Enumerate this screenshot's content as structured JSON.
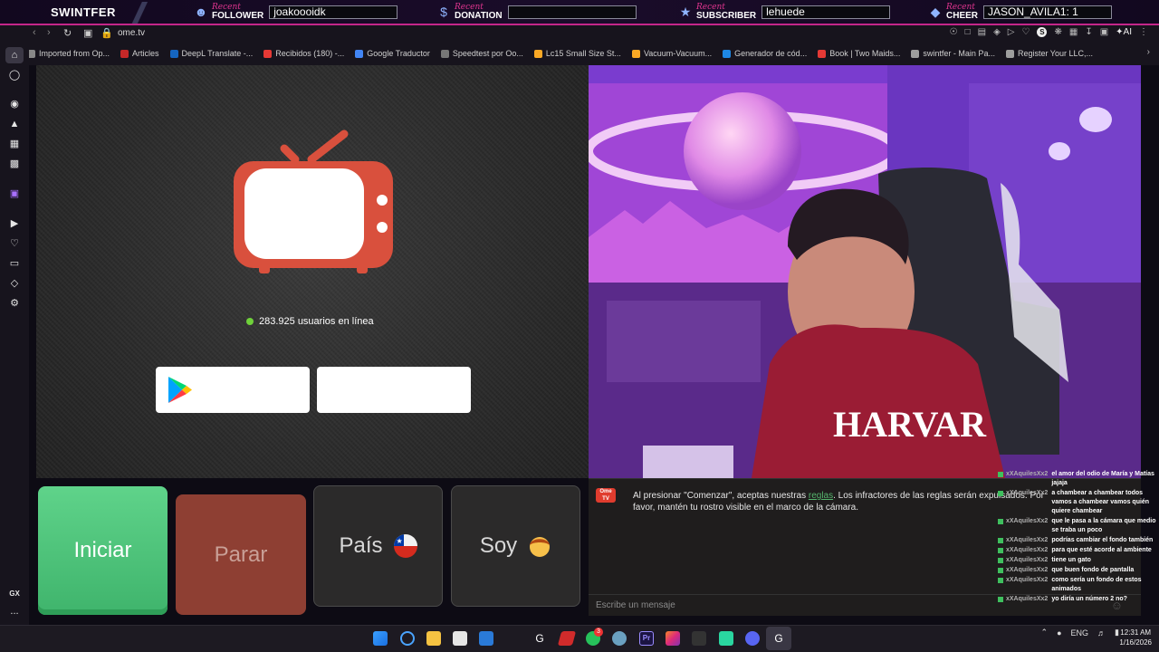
{
  "overlay": {
    "brand": "SWINTFER",
    "recent": "Recent",
    "follower": {
      "label": "FOLLOWER",
      "value": "joakoooidk"
    },
    "donation": {
      "label": "DONATION",
      "value": ""
    },
    "subscriber": {
      "label": "SUBSCRIBER",
      "value": "lehuede"
    },
    "cheer": {
      "label": "CHEER",
      "value": "JASON_AVILA1: 1"
    }
  },
  "browser": {
    "url": "ome.tv",
    "bookmarks": [
      {
        "label": "Imported from Op...",
        "color": "#888888"
      },
      {
        "label": "Articles",
        "color": "#c62828"
      },
      {
        "label": "DeepL Translate -...",
        "color": "#1565c0"
      },
      {
        "label": "Recibidos (180) -...",
        "color": "#e53935"
      },
      {
        "label": "Google Traductor",
        "color": "#4285f4"
      },
      {
        "label": "Speedtest por Oo...",
        "color": "#777777"
      },
      {
        "label": "Lc15 Small Size St...",
        "color": "#f9a825"
      },
      {
        "label": "Vacuum-Vacuum...",
        "color": "#f9a825"
      },
      {
        "label": "Generador de cód...",
        "color": "#1e88e5"
      },
      {
        "label": "Book | Two Maids...",
        "color": "#e53935"
      },
      {
        "label": "swintfer - Main Pa...",
        "color": "#9e9e9e"
      },
      {
        "label": "Register Your LLC,...",
        "color": "#9e9e9e"
      }
    ],
    "ai_label": "AI"
  },
  "ome": {
    "online_text": "283.925 usuarios en línea",
    "start_label": "Iniciar",
    "stop_label": "Parar",
    "country_label": "País",
    "gender_label": "Soy",
    "chat_logo": "Ome TV",
    "chat_notice_pre": "Al presionar \"Comenzar\", aceptas nuestras ",
    "chat_notice_link": "reglas",
    "chat_notice_post": ". Los infractores de las reglas serán expulsados. Por favor, mantén tu rostro visible en el marco de la cámara.",
    "chat_placeholder": "Escribe un mensaje"
  },
  "twitch_chat": [
    {
      "user": "xXAquilesXx2",
      "text": "el amor del odio de María y Matías jajaja"
    },
    {
      "user": "xXAquilesXx2",
      "text": "a chambear a chambear todos vamos a chambear vamos quién quiere chambear"
    },
    {
      "user": "xXAquilesXx2",
      "text": "que le pasa a la cámara que medio se traba un poco"
    },
    {
      "user": "xXAquilesXx2",
      "text": "podrías cambiar el fondo también"
    },
    {
      "user": "xXAquilesXx2",
      "text": "para que esté acorde al ambiente"
    },
    {
      "user": "xXAquilesXx2",
      "text": "tiene un gato"
    },
    {
      "user": "xXAquilesXx2",
      "text": "que buen fondo de pantalla"
    },
    {
      "user": "xXAquilesXx2",
      "text": "como sería un fondo de estos animados"
    },
    {
      "user": "xXAquilesXx2",
      "text": "yo diría un número 2 no?"
    }
  ],
  "sidebar": {
    "gx_label": "GX",
    "more_label": "..."
  },
  "taskbar": {
    "lang": "ENG",
    "time": "12:31 AM",
    "date": "1/16/2026",
    "badge_count": "3"
  }
}
